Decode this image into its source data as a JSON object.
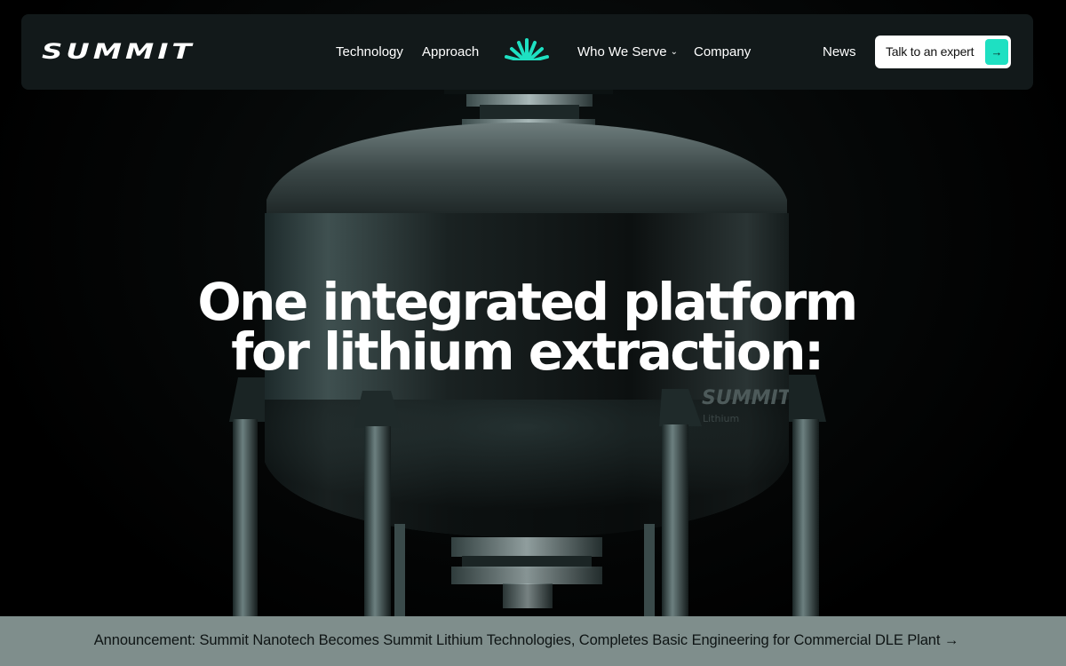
{
  "nav": {
    "logo_text": "SUMMIT",
    "links": {
      "technology": "Technology",
      "approach": "Approach",
      "who_we_serve": "Who We Serve",
      "company": "Company",
      "news": "News"
    },
    "center_icon": "sunburst-logo-mark",
    "cta_label": "Talk to an expert",
    "cta_arrow": "→"
  },
  "hero": {
    "headline_line1": "One integrated platform",
    "headline_line2": "for lithium extraction:",
    "vessel_brand": "SUMMIT",
    "vessel_sub": "Lithium"
  },
  "announcement": {
    "text": "Announcement: Summit Nanotech Becomes Summit Lithium Technologies, Completes Basic Engineering for Commercial DLE Plant →"
  },
  "colors": {
    "accent": "#1ee0c2",
    "nav_bg": "#12191a",
    "announce_bg": "#7f8e8c"
  }
}
